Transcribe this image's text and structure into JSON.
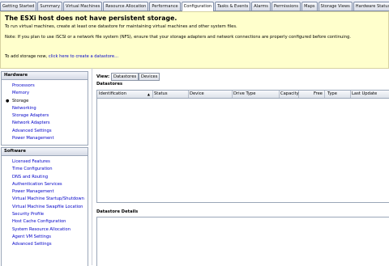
{
  "tabs": [
    "Getting Started",
    "Summary",
    "Virtual Machines",
    "Resource Allocation",
    "Performance",
    "Configuration",
    "Tasks & Events",
    "Alarms",
    "Permissions",
    "Maps",
    "Storage Views",
    "Hardware Status"
  ],
  "active_tab": "Configuration",
  "warning": {
    "title": "The ESXi host does not have persistent storage.",
    "line1": "To run virtual machines, create at least one datastore for maintaining virtual machines and other system files.",
    "note": "Note: If you plan to use iSCSI or a network file system (NFS), ensure that your storage adapters and network connections are properly configured before continuing.",
    "add_prefix": "To add storage now,",
    "add_link": "click here to create a datastore..."
  },
  "hardware": {
    "title": "Hardware",
    "items": [
      "Processors",
      "Memory",
      "Storage",
      "Networking",
      "Storage Adapters",
      "Network Adapters",
      "Advanced Settings",
      "Power Management"
    ],
    "selected": "Storage"
  },
  "software": {
    "title": "Software",
    "items": [
      "Licensed Features",
      "Time Configuration",
      "DNS and Routing",
      "Authentication Services",
      "Power Management",
      "Virtual Machine Startup/Shutdown",
      "Virtual Machine Swapfile Location",
      "Security Profile",
      "Host Cache Configuration",
      "System Resource Allocation",
      "Agent VM Settings",
      "Advanced Settings"
    ]
  },
  "view": {
    "label": "View:",
    "buttons": [
      "Datastores",
      "Devices"
    ]
  },
  "datastores": {
    "title": "Datastores",
    "columns": [
      "Identification",
      "Status",
      "Device",
      "Drive Type",
      "Capacity",
      "Free",
      "Type",
      "Last Update"
    ]
  },
  "details": {
    "title": "Datastore Details"
  }
}
